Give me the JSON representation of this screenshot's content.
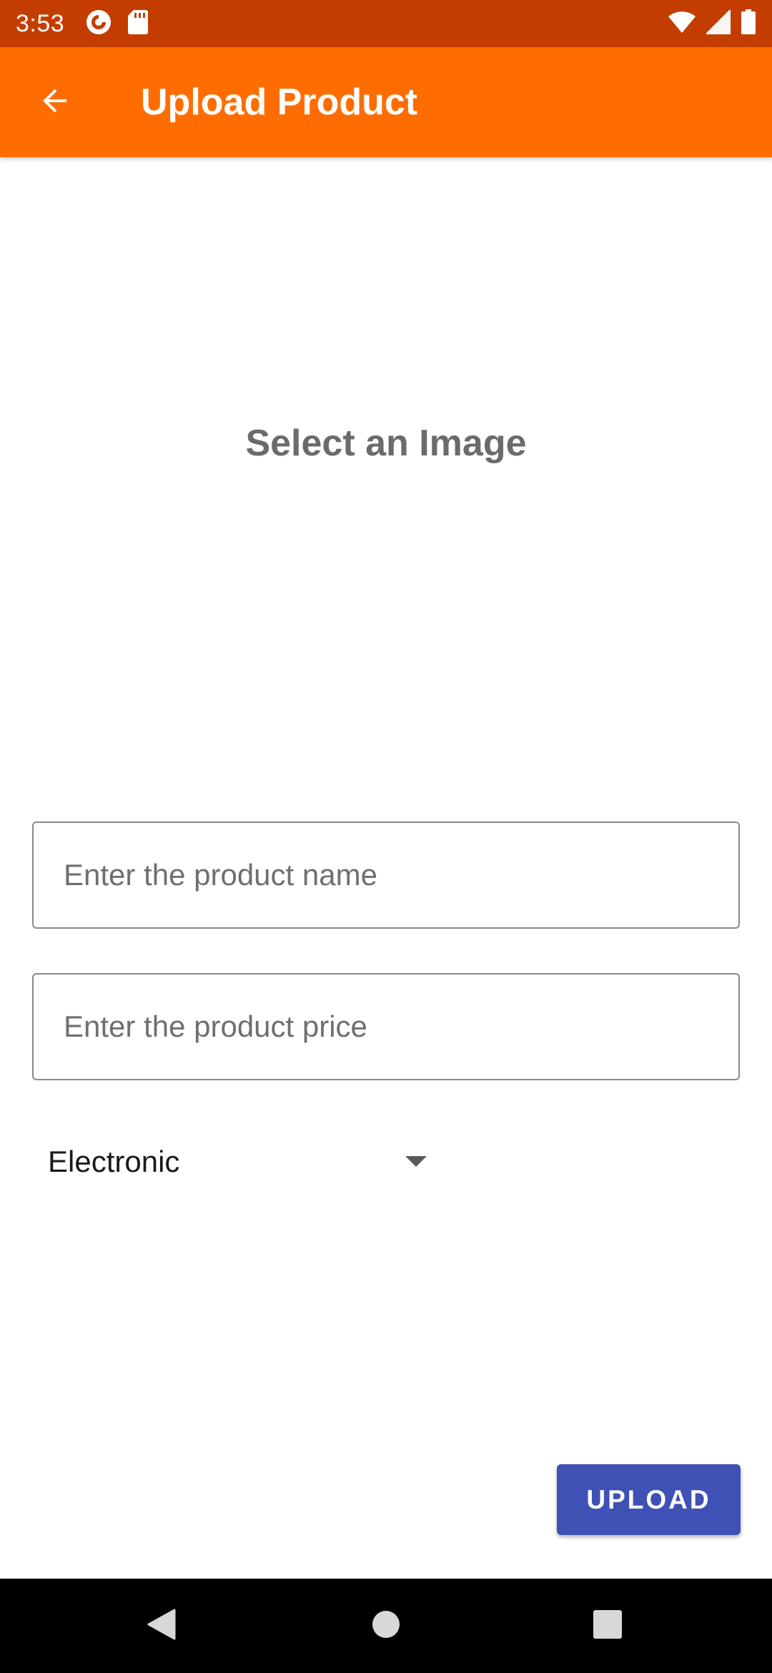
{
  "status_bar": {
    "time": "3:53",
    "left_icons": [
      "pocket-casts-icon",
      "sd-card-icon"
    ],
    "right_icons": [
      "wifi-icon",
      "cell-signal-icon",
      "battery-icon"
    ],
    "background_color": "#c43d00"
  },
  "app_bar": {
    "title": "Upload Product",
    "back_icon": "arrow-back-icon",
    "background_color": "#ff6d00"
  },
  "image_picker": {
    "label": "Select an Image"
  },
  "form": {
    "name_field": {
      "placeholder": "Enter the product name",
      "value": ""
    },
    "price_field": {
      "placeholder": "Enter the product price",
      "value": ""
    },
    "category": {
      "selected": "Electronic",
      "icon": "dropdown-arrow-icon"
    }
  },
  "actions": {
    "upload_label": "UPLOAD",
    "upload_color": "#3f51b5"
  },
  "nav_bar": {
    "icons": [
      "nav-back-icon",
      "nav-home-icon",
      "nav-recents-icon"
    ]
  }
}
